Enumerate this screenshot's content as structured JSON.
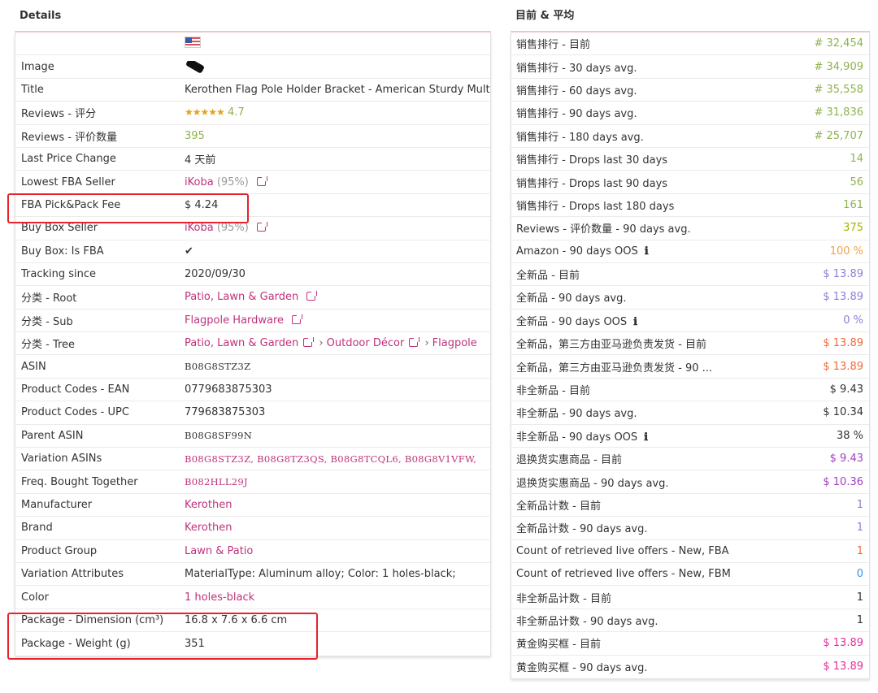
{
  "left": {
    "title": "Details",
    "rows": {
      "image_label": "Image",
      "title_label": "Title",
      "title_value": "Kerothen Flag Pole Holder Bracket - American Sturdy Multi",
      "reviews_rating_label": "Reviews - 评分",
      "reviews_rating_stars": "★★★★★",
      "reviews_rating_value": "4.7",
      "reviews_count_label": "Reviews - 评价数量",
      "reviews_count_value": "395",
      "last_price_change_label": "Last Price Change",
      "last_price_change_value": "4 天前",
      "lowest_fba_label": "Lowest FBA Seller",
      "lowest_fba_seller": "iKoba",
      "lowest_fba_pct": "(95%)",
      "fba_fee_label": "FBA Pick&Pack Fee",
      "fba_fee_value": "$ 4.24",
      "buybox_seller_label": "Buy Box Seller",
      "buybox_seller": "iKoba",
      "buybox_seller_pct": "(95%)",
      "buybox_fba_label": "Buy Box: Is FBA",
      "buybox_fba_value": "✔",
      "tracking_label": "Tracking since",
      "tracking_value": "2020/09/30",
      "cat_root_label": "分类 - Root",
      "cat_root_value": "Patio, Lawn & Garden",
      "cat_sub_label": "分类 - Sub",
      "cat_sub_value": "Flagpole Hardware",
      "cat_tree_label": "分类 - Tree",
      "cat_tree_1": "Patio, Lawn & Garden",
      "cat_tree_sep": "›",
      "cat_tree_2": "Outdoor Décor",
      "cat_tree_3": "Flagpole",
      "asin_label": "ASIN",
      "asin_value": "B08G8STZ3Z",
      "ean_label": "Product Codes - EAN",
      "ean_value": "0779683875303",
      "upc_label": "Product Codes - UPC",
      "upc_value": "779683875303",
      "parent_asin_label": "Parent ASIN",
      "parent_asin_value": "B08G8SF99N",
      "variation_asins_label": "Variation ASINs",
      "variation_asins_value": "B08G8STZ3Z, B08G8TZ3QS, B08G8TCQL6, B08G8V1VFW,",
      "fbt_label": "Freq. Bought Together",
      "fbt_value": "B082HLL29J",
      "manufacturer_label": "Manufacturer",
      "manufacturer_value": "Kerothen",
      "brand_label": "Brand",
      "brand_value": "Kerothen",
      "product_group_label": "Product Group",
      "product_group_value": "Lawn & Patio",
      "variation_attr_label": "Variation Attributes",
      "variation_attr_value": "MaterialType: Aluminum alloy; Color: 1 holes-black;",
      "color_label": "Color",
      "color_value": "1 holes-black",
      "pkg_dim_label": "Package - Dimension (cm³)",
      "pkg_dim_value": "16.8 x 7.6 x 6.6 cm",
      "pkg_weight_label": "Package - Weight (g)",
      "pkg_weight_value": "351"
    }
  },
  "right": {
    "title": "目前 & 平均",
    "rows": [
      {
        "label": "销售排行 - 目前",
        "value": "# 32,454",
        "color": "#8fb24e"
      },
      {
        "label": "销售排行 - 30 days avg.",
        "value": "# 34,909",
        "color": "#8fb24e"
      },
      {
        "label": "销售排行 - 60 days avg.",
        "value": "# 35,558",
        "color": "#8fb24e"
      },
      {
        "label": "销售排行 - 90 days avg.",
        "value": "# 31,836",
        "color": "#8fb24e"
      },
      {
        "label": "销售排行 - 180 days avg.",
        "value": "# 25,707",
        "color": "#8fb24e"
      },
      {
        "label": "销售排行 - Drops last 30 days",
        "value": "14",
        "color": "#8fb24e"
      },
      {
        "label": "销售排行 - Drops last 90 days",
        "value": "56",
        "color": "#8fb24e"
      },
      {
        "label": "销售排行 - Drops last 180 days",
        "value": "161",
        "color": "#8fb24e"
      },
      {
        "label": "Reviews - 评价数量 - 90 days avg.",
        "value": "375",
        "color": "#a5b300"
      },
      {
        "label": "Amazon - 90 days OOS",
        "info": "ℹ",
        "value": "100 %",
        "color": "#f0a04b"
      },
      {
        "label": "全新品 - 目前",
        "value": "$ 13.89",
        "color": "#8b7fd8"
      },
      {
        "label": "全新品 - 90 days avg.",
        "value": "$ 13.89",
        "color": "#8b7fd8"
      },
      {
        "label": "全新品 - 90 days OOS",
        "info": "ℹ",
        "value": "0 %",
        "color": "#8b7fd8"
      },
      {
        "label": "全新品，第三方由亚马逊负责发货 - 目前",
        "value": "$ 13.89",
        "color": "#f06a3b"
      },
      {
        "label": "全新品，第三方由亚马逊负责发货 - 90 ...",
        "value": "$ 13.89",
        "color": "#f06a3b"
      },
      {
        "label": "非全新品 - 目前",
        "value": "$ 9.43",
        "color": "#333333"
      },
      {
        "label": "非全新品 - 90 days avg.",
        "value": "$ 10.34",
        "color": "#333333"
      },
      {
        "label": "非全新品 - 90 days OOS",
        "info": "ℹ",
        "value": "38 %",
        "color": "#333333"
      },
      {
        "label": "退换货实惠商品 - 目前",
        "value": "$ 9.43",
        "color": "#a23ec4"
      },
      {
        "label": "退换货实惠商品 - 90 days avg.",
        "value": "$ 10.36",
        "color": "#a23ec4"
      },
      {
        "label": "全新品计数 - 目前",
        "value": "1",
        "color": "#8b7fd8"
      },
      {
        "label": "全新品计数 - 90 days avg.",
        "value": "1",
        "color": "#8b7fd8"
      },
      {
        "label": "Count of retrieved live offers - New, FBA",
        "value": "1",
        "color": "#f06a3b"
      },
      {
        "label": "Count of retrieved live offers - New, FBM",
        "value": "0",
        "color": "#3b8fe0"
      },
      {
        "label": "非全新品计数 - 目前",
        "value": "1",
        "color": "#333333"
      },
      {
        "label": "非全新品计数 - 90 days avg.",
        "value": "1",
        "color": "#333333"
      },
      {
        "label": "黄金购买框 - 目前",
        "value": "$ 13.89",
        "color": "#e0309a"
      },
      {
        "label": "黄金购买框 - 90 days avg.",
        "value": "$ 13.89",
        "color": "#e0309a"
      }
    ]
  }
}
